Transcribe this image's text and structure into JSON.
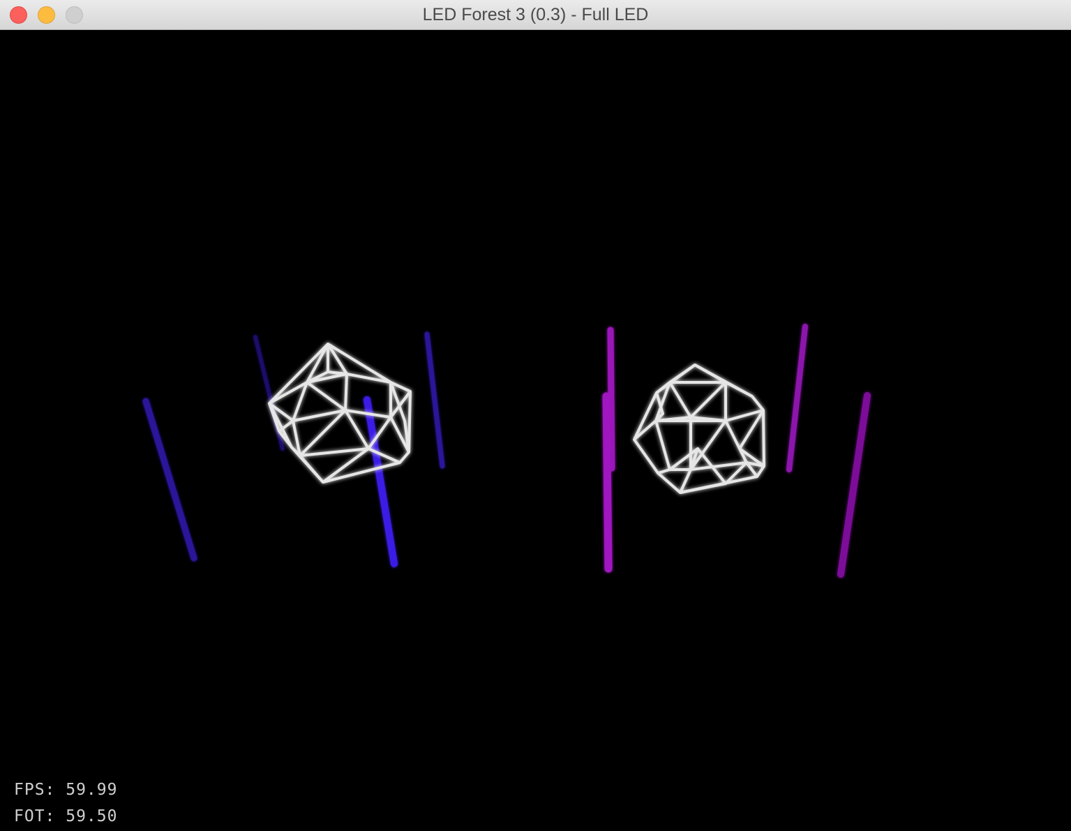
{
  "window": {
    "title": "LED Forest 3 (0.3) - Full LED"
  },
  "colors": {
    "background": "#000000",
    "wireframe": "#e6e6e6",
    "led_blue_dim": "#2a1399",
    "led_blue_bright": "#3a1ee6",
    "led_purple": "#a014c0"
  },
  "hud": {
    "fps": "FPS: 59.99",
    "fot": "FOT: 59.50"
  }
}
